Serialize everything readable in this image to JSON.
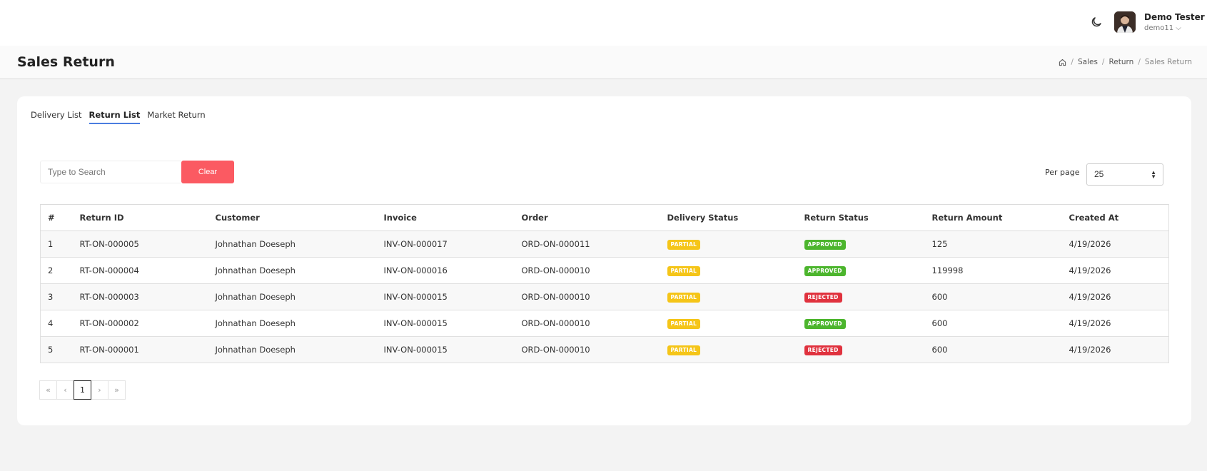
{
  "user": {
    "name": "Demo Tester",
    "username": "demo11",
    "caret": "⌵"
  },
  "page": {
    "title": "Sales Return"
  },
  "breadcrumb": {
    "sep": "/",
    "items": [
      "Sales",
      "Return"
    ],
    "current": "Sales Return"
  },
  "tabs": [
    {
      "label": "Delivery List",
      "active": false
    },
    {
      "label": "Return List",
      "active": true
    },
    {
      "label": "Market Return",
      "active": false
    }
  ],
  "search": {
    "placeholder": "Type to Search",
    "value": "",
    "clear_label": "Clear"
  },
  "per_page": {
    "label": "Per page",
    "value": "25"
  },
  "table": {
    "columns": [
      "#",
      "Return ID",
      "Customer",
      "Invoice",
      "Order",
      "Delivery Status",
      "Return Status",
      "Return Amount",
      "Created At"
    ],
    "rows": [
      {
        "num": "1",
        "return_id": "RT-ON-000005",
        "customer": "Johnathan Doeseph",
        "invoice": "INV-ON-000017",
        "order": "ORD-ON-000011",
        "delivery_status": "PARTIAL",
        "return_status": "APPROVED",
        "amount": "125",
        "created": "4/19/2026"
      },
      {
        "num": "2",
        "return_id": "RT-ON-000004",
        "customer": "Johnathan Doeseph",
        "invoice": "INV-ON-000016",
        "order": "ORD-ON-000010",
        "delivery_status": "PARTIAL",
        "return_status": "APPROVED",
        "amount": "119998",
        "created": "4/19/2026"
      },
      {
        "num": "3",
        "return_id": "RT-ON-000003",
        "customer": "Johnathan Doeseph",
        "invoice": "INV-ON-000015",
        "order": "ORD-ON-000010",
        "delivery_status": "PARTIAL",
        "return_status": "REJECTED",
        "amount": "600",
        "created": "4/19/2026"
      },
      {
        "num": "4",
        "return_id": "RT-ON-000002",
        "customer": "Johnathan Doeseph",
        "invoice": "INV-ON-000015",
        "order": "ORD-ON-000010",
        "delivery_status": "PARTIAL",
        "return_status": "APPROVED",
        "amount": "600",
        "created": "4/19/2026"
      },
      {
        "num": "5",
        "return_id": "RT-ON-000001",
        "customer": "Johnathan Doeseph",
        "invoice": "INV-ON-000015",
        "order": "ORD-ON-000010",
        "delivery_status": "PARTIAL",
        "return_status": "REJECTED",
        "amount": "600",
        "created": "4/19/2026"
      }
    ]
  },
  "pagination": {
    "first": "«",
    "prev": "‹",
    "current": "1",
    "next": "›",
    "last": "»"
  },
  "colors": {
    "accent": "#4a7de0",
    "clear_button": "#fb5a62",
    "partial": "#f5c518",
    "approved": "#4cb52d",
    "rejected": "#e0323e"
  },
  "icons": {
    "theme_toggle": "moon-icon",
    "home": "home-icon",
    "select": "sort-arrows-icon"
  }
}
